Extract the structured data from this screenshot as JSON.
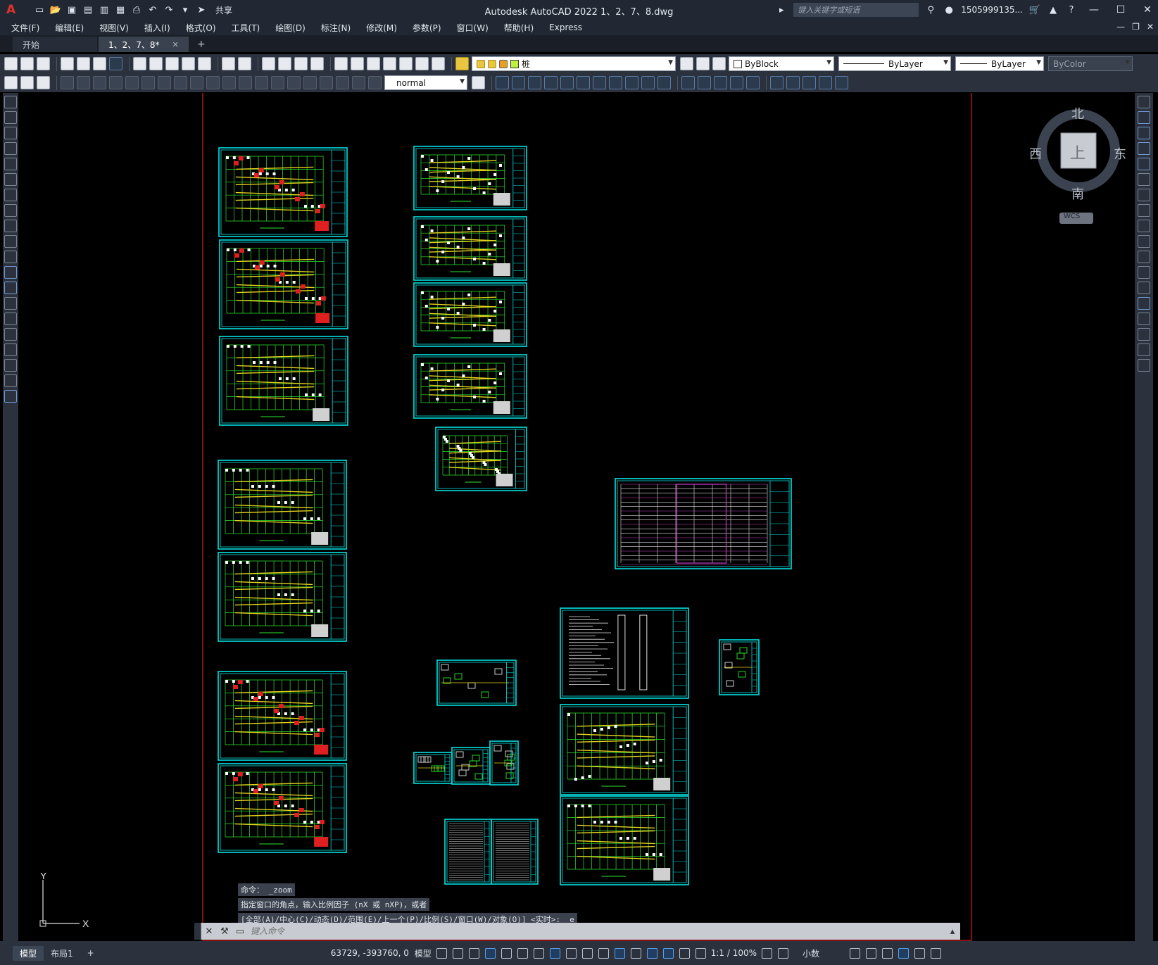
{
  "window": {
    "title": "Autodesk AutoCAD 2022    1、2、7、8.dwg",
    "logo": "A",
    "share_label": "共享",
    "search_placeholder": "键入关键字或短语",
    "user": "1505999135...",
    "help": "?",
    "min": "—",
    "max": "☐",
    "close": "✕"
  },
  "menu": [
    "文件(F)",
    "编辑(E)",
    "视图(V)",
    "插入(I)",
    "格式(O)",
    "工具(T)",
    "绘图(D)",
    "标注(N)",
    "修改(M)",
    "参数(P)",
    "窗口(W)",
    "帮助(H)",
    "Express"
  ],
  "mdi_controls": [
    "—",
    "❐",
    "✕"
  ],
  "tabs": [
    {
      "label": "开始"
    },
    {
      "label": "1、2、7、8*",
      "close": "✕"
    }
  ],
  "add_tab": "+",
  "toolbar": {
    "layer_name": "桩",
    "color_value": "ByBlock",
    "linetype_value": "ByLayer",
    "lineweight_value": "ByLayer",
    "plotstyle_value": "ByColor",
    "dimstyle_value": "normal"
  },
  "viewcube": {
    "north": "北",
    "south": "南",
    "east": "东",
    "west": "西",
    "face": "上",
    "wcs": "WCS"
  },
  "ucs": {
    "x": "X",
    "y": "Y"
  },
  "command": {
    "history": [
      "命令： _zoom",
      "指定窗口的角点，输入比例因子 (nX 或 nXP)，或者",
      "[全部(A)/中心(C)/动态(D)/范围(E)/上一个(P)/比例(S)/窗口(W)/对象(O)] <实时>: _e"
    ],
    "placeholder": "键入命令"
  },
  "status": {
    "layout_tabs": [
      "模型",
      "布局1"
    ],
    "add_layout": "+",
    "coords": "63729, -393760, 0",
    "mode": "模型",
    "scale": "1:1 / 100%",
    "units": "小数"
  },
  "colors": {
    "sheet_border": "#00e0e0",
    "drawing_green": "#2ee62e",
    "drawing_yellow": "#e6d21e",
    "drawing_red": "#e02020",
    "limits_red": "#d01818",
    "table_magenta": "#c040c0"
  }
}
